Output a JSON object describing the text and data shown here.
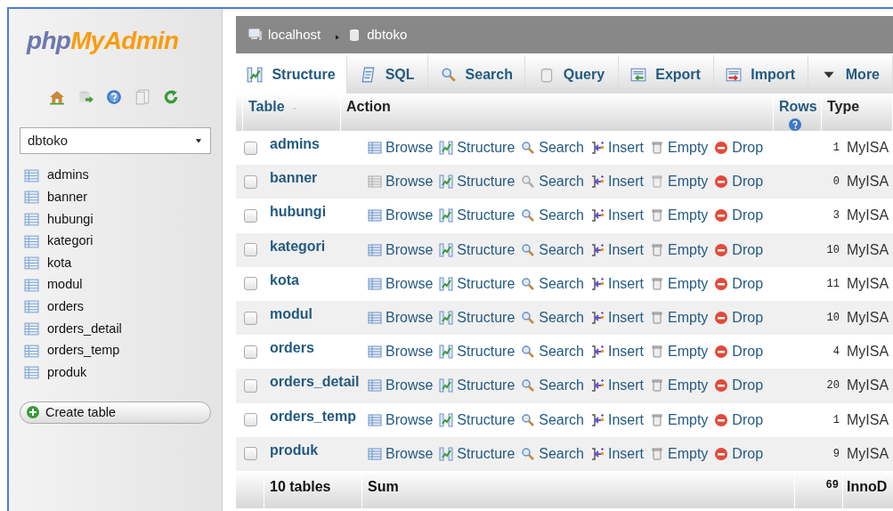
{
  "sidebar": {
    "logo": [
      "php",
      "MyAdmin"
    ],
    "database_select": {
      "value": "dbtoko"
    },
    "tables": [
      "admins",
      "banner",
      "hubungi",
      "kategori",
      "kota",
      "modul",
      "orders",
      "orders_detail",
      "orders_temp",
      "produk"
    ],
    "create_button": "Create table"
  },
  "breadcrumb": [
    "localhost",
    "dbtoko"
  ],
  "tabs": [
    {
      "label": "Structure",
      "selected": true
    },
    {
      "label": "SQL",
      "selected": false
    },
    {
      "label": "Search",
      "selected": false
    },
    {
      "label": "Query",
      "selected": false
    },
    {
      "label": "Export",
      "selected": false
    },
    {
      "label": "Import",
      "selected": false
    },
    {
      "label": "More",
      "selected": false
    }
  ],
  "table": {
    "columns": [
      "Table",
      "Action",
      "Rows",
      "Type"
    ],
    "rows": [
      {
        "name": "admins",
        "checked": false,
        "empty": false,
        "actions": [
          "Browse",
          "Structure",
          "Search",
          "Insert",
          "Empty",
          "Drop"
        ],
        "rows": "1",
        "type": "MyISA"
      },
      {
        "name": "banner",
        "checked": false,
        "empty": true,
        "actions": [
          "Browse",
          "Structure",
          "Search",
          "Insert",
          "Empty",
          "Drop"
        ],
        "rows": "0",
        "type": "MyISA"
      },
      {
        "name": "hubungi",
        "checked": false,
        "empty": false,
        "actions": [
          "Browse",
          "Structure",
          "Search",
          "Insert",
          "Empty",
          "Drop"
        ],
        "rows": "3",
        "type": "MyISA"
      },
      {
        "name": "kategori",
        "checked": false,
        "empty": false,
        "actions": [
          "Browse",
          "Structure",
          "Search",
          "Insert",
          "Empty",
          "Drop"
        ],
        "rows": "10",
        "type": "MyISA"
      },
      {
        "name": "kota",
        "checked": false,
        "empty": false,
        "actions": [
          "Browse",
          "Structure",
          "Search",
          "Insert",
          "Empty",
          "Drop"
        ],
        "rows": "11",
        "type": "MyISA"
      },
      {
        "name": "modul",
        "checked": false,
        "empty": false,
        "actions": [
          "Browse",
          "Structure",
          "Search",
          "Insert",
          "Empty",
          "Drop"
        ],
        "rows": "10",
        "type": "MyISA"
      },
      {
        "name": "orders",
        "checked": false,
        "empty": false,
        "actions": [
          "Browse",
          "Structure",
          "Search",
          "Insert",
          "Empty",
          "Drop"
        ],
        "rows": "4",
        "type": "MyISA"
      },
      {
        "name": "orders_detail",
        "checked": false,
        "empty": false,
        "actions": [
          "Browse",
          "Structure",
          "Search",
          "Insert",
          "Empty",
          "Drop"
        ],
        "rows": "20",
        "type": "MyISA"
      },
      {
        "name": "orders_temp",
        "checked": false,
        "empty": false,
        "actions": [
          "Browse",
          "Structure",
          "Search",
          "Insert",
          "Empty",
          "Drop"
        ],
        "rows": "1",
        "type": "MyISA"
      },
      {
        "name": "produk",
        "checked": false,
        "empty": false,
        "actions": [
          "Browse",
          "Structure",
          "Search",
          "Insert",
          "Empty",
          "Drop"
        ],
        "rows": "9",
        "type": "MyISA"
      }
    ],
    "footer": {
      "label": "10 tables",
      "action": "Sum",
      "rows": "69",
      "type": "InnoD"
    }
  }
}
